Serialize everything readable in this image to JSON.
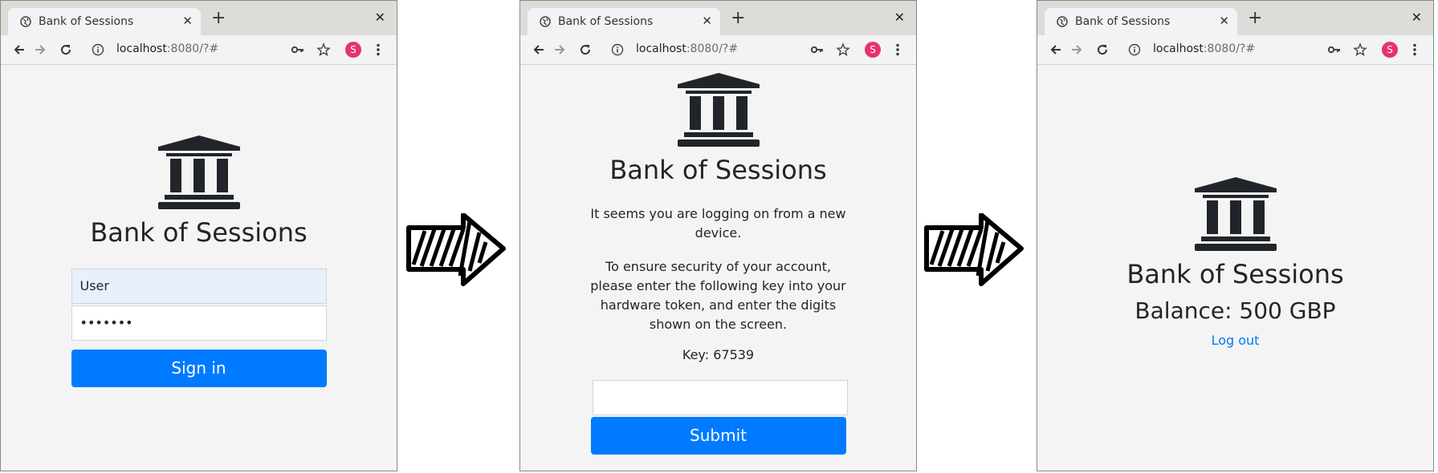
{
  "browser": {
    "tab_title": "Bank of Sessions",
    "url_host": "localhost",
    "url_rest": ":8080/?#",
    "avatar_letter": "S",
    "avatar_color": "#e8336d"
  },
  "brand": {
    "name": "Bank of Sessions"
  },
  "login": {
    "username_value": "User",
    "password_value": "•••••••",
    "signin_label": "Sign in"
  },
  "verify": {
    "message_1": "It seems you are logging on from a new device.",
    "message_2": "To ensure security of your account, please enter the following key into your hardware token, and enter the digits shown on the screen.",
    "key_text": "Key: 67539",
    "code_value": "",
    "submit_label": "Submit"
  },
  "account": {
    "balance_text": "Balance: 500 GBP",
    "logout_label": "Log out"
  },
  "colors": {
    "primary": "#007bff",
    "page_bg": "#f4f4f4",
    "text": "#212529"
  }
}
